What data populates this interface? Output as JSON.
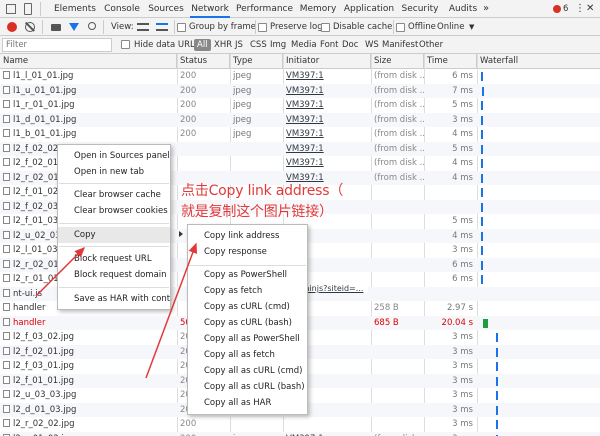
{
  "tabs": [
    "Elements",
    "Console",
    "Sources",
    "Network",
    "Performance",
    "Memory",
    "Application",
    "Security",
    "Audits"
  ],
  "active_tab": "Network",
  "overflow": "»",
  "error_count": "6",
  "toolbar": {
    "view_label": "View:",
    "group_by_frame": "Group by frame",
    "preserve_log": "Preserve log",
    "disable_cache": "Disable cache",
    "offline": "Offline",
    "online": "Online"
  },
  "filterbar": {
    "placeholder": "Filter",
    "hide_data_urls": "Hide data URLs",
    "types": [
      "All",
      "XHR",
      "JS",
      "CSS",
      "Img",
      "Media",
      "Font",
      "Doc",
      "WS",
      "Manifest",
      "Other"
    ]
  },
  "columns": [
    "Name",
    "Status",
    "Type",
    "Initiator",
    "Size",
    "Time",
    "Waterfall"
  ],
  "rows": [
    {
      "name": "l1_l_01_01.jpg",
      "status": "200",
      "type": "jpeg",
      "init": "VM397:1",
      "size": "(from disk ...",
      "time": "6 ms"
    },
    {
      "name": "l1_u_01_01.jpg",
      "status": "200",
      "type": "jpeg",
      "init": "VM397:1",
      "size": "(from disk ...",
      "time": "7 ms"
    },
    {
      "name": "l1_r_01_01.jpg",
      "status": "200",
      "type": "jpeg",
      "init": "VM397:1",
      "size": "(from disk ...",
      "time": "5 ms"
    },
    {
      "name": "l1_d_01_01.jpg",
      "status": "200",
      "type": "jpeg",
      "init": "VM397:1",
      "size": "(from disk ...",
      "time": "3 ms"
    },
    {
      "name": "l1_b_01_01.jpg",
      "status": "200",
      "type": "jpeg",
      "init": "VM397:1",
      "size": "(from disk ...",
      "time": "4 ms"
    },
    {
      "name": "l2_f_02_02.",
      "status": "",
      "type": "",
      "init": "VM397:1",
      "size": "(from disk ...",
      "time": "5 ms"
    },
    {
      "name": "l2_f_02_01.",
      "status": "",
      "type": "",
      "init": "VM397:1",
      "size": "(from disk ...",
      "time": "4 ms"
    },
    {
      "name": "l2_r_02_01.",
      "status": "",
      "type": "",
      "init": "VM397:1",
      "size": "(from disk ...",
      "time": "4 ms"
    },
    {
      "name": "l2_f_01_02.",
      "status": "",
      "type": "",
      "init": "",
      "size": "",
      "time": ""
    },
    {
      "name": "l2_f_02_03.",
      "status": "",
      "type": "",
      "init": "",
      "size": "",
      "time": ""
    },
    {
      "name": "l2_f_01_03.",
      "status": "",
      "type": "",
      "init": "",
      "size": "",
      "time": "5 ms"
    },
    {
      "name": "l2_u_02_03.",
      "status": "",
      "type": "",
      "init": "",
      "size": "",
      "time": "4 ms"
    },
    {
      "name": "l2_l_01_03.",
      "status": "",
      "type": "",
      "init": "",
      "size": "",
      "time": "3 ms"
    },
    {
      "name": "l2_r_02_01.",
      "status": "",
      "type": "",
      "init": "",
      "size": "",
      "time": "6 ms"
    },
    {
      "name": "l2_r_01_01.",
      "status": "",
      "type": "",
      "init": "",
      "size": "",
      "time": "6 ms"
    },
    {
      "name": "nt-ui.js",
      "status": "",
      "type": "",
      "init": "",
      "size": "",
      "time": ""
    },
    {
      "name": "handler",
      "status": "",
      "type": "",
      "init": "",
      "size": "258 B",
      "time": "2.97 s"
    },
    {
      "name": "handler",
      "status": "50",
      "type": "",
      "init": "",
      "size": "685 B",
      "time": "20.04 s"
    },
    {
      "name": "l2_f_03_02.jpg",
      "status": "200",
      "type": "",
      "init": "",
      "size": "",
      "time": "3 ms"
    },
    {
      "name": "l2_f_02_01.jpg",
      "status": "200",
      "type": "",
      "init": "",
      "size": "",
      "time": "3 ms"
    },
    {
      "name": "l2_f_03_01.jpg",
      "status": "200",
      "type": "",
      "init": "",
      "size": "",
      "time": "3 ms"
    },
    {
      "name": "l2_f_01_01.jpg",
      "status": "200",
      "type": "",
      "init": "",
      "size": "",
      "time": "3 ms"
    },
    {
      "name": "l2_u_03_03.jpg",
      "status": "200",
      "type": "",
      "init": "",
      "size": "",
      "time": "3 ms"
    },
    {
      "name": "l2_d_01_03.jpg",
      "status": "200",
      "type": "",
      "init": "",
      "size": "",
      "time": "3 ms"
    },
    {
      "name": "l2_r_02_02.jpg",
      "status": "200",
      "type": "",
      "init": "",
      "size": "",
      "time": "3 ms"
    },
    {
      "name": "l2_r_01_02.jpg",
      "status": "200",
      "type": "jpeg",
      "init": "VM397:1",
      "size": "(from disk ...",
      "time": "3 ms"
    }
  ],
  "initiator_partial": "...minjs?siteid=...",
  "context_menu": {
    "items": [
      "Open in Sources panel",
      "Open in new tab",
      "Clear browser cache",
      "Clear browser cookies",
      "Copy",
      "Block request URL",
      "Block request domain",
      "Save as HAR with conten"
    ]
  },
  "copy_submenu": {
    "items": [
      "Copy link address",
      "Copy response",
      "Copy as PowerShell",
      "Copy as fetch",
      "Copy as cURL (cmd)",
      "Copy as cURL (bash)",
      "Copy all as PowerShell",
      "Copy all as fetch",
      "Copy all as cURL (cmd)",
      "Copy all as cURL (bash)",
      "Copy all as HAR"
    ]
  },
  "annotation": {
    "line1": "点击Copy link address（",
    "line2": "就是复制这个图片链接）"
  },
  "colors": {
    "accent": "#1a73e8",
    "record": "#d93025",
    "annotation": "#e23a3a"
  }
}
